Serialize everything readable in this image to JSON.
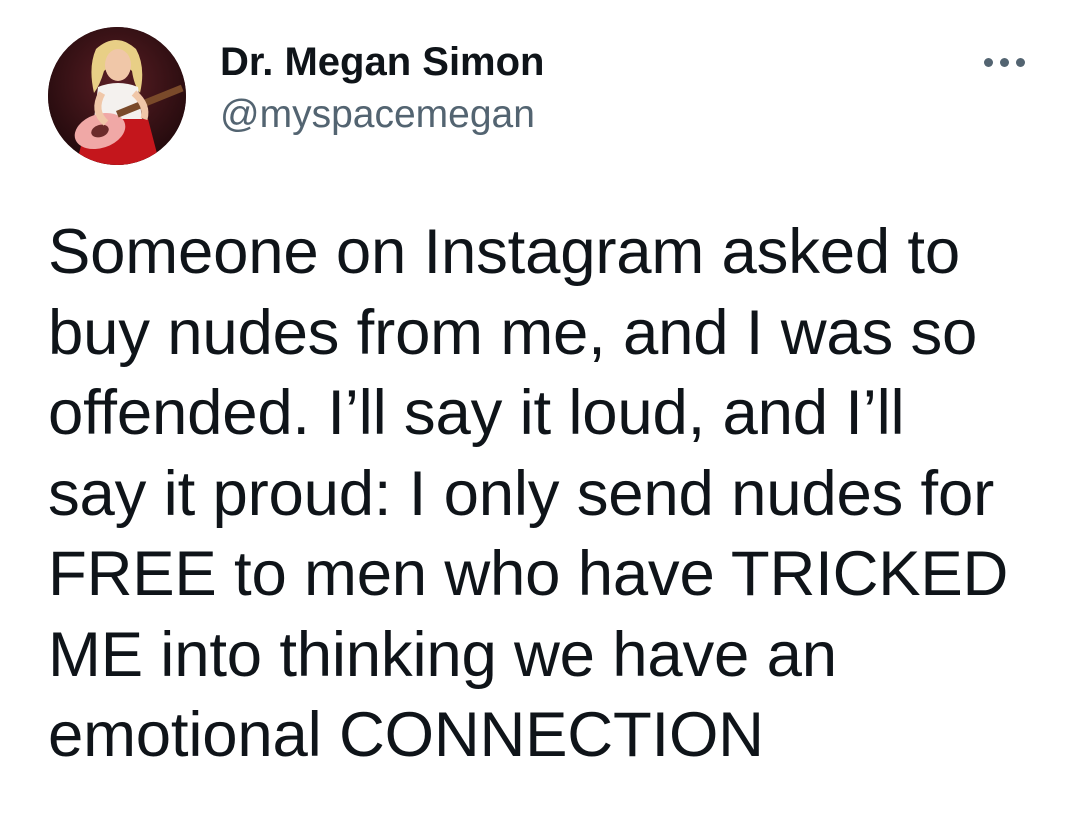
{
  "tweet": {
    "author": {
      "display_name": "Dr. Megan Simon",
      "handle": "@myspacemegan",
      "avatar_icon": "profile-photo-guitarist"
    },
    "more_icon": "more-horizontal-icon",
    "text_lines": [
      "Someone on Instagram asked to",
      "buy nudes from me, and I was so",
      "offended. I’ll say it loud, and I’ll",
      "say it proud: I only send nudes for",
      "FREE to men who have TRICKED",
      "ME into thinking we have an",
      "emotional CONNECTION"
    ]
  },
  "colors": {
    "text_primary": "#0f1419",
    "text_secondary": "#536471",
    "background": "#ffffff"
  }
}
